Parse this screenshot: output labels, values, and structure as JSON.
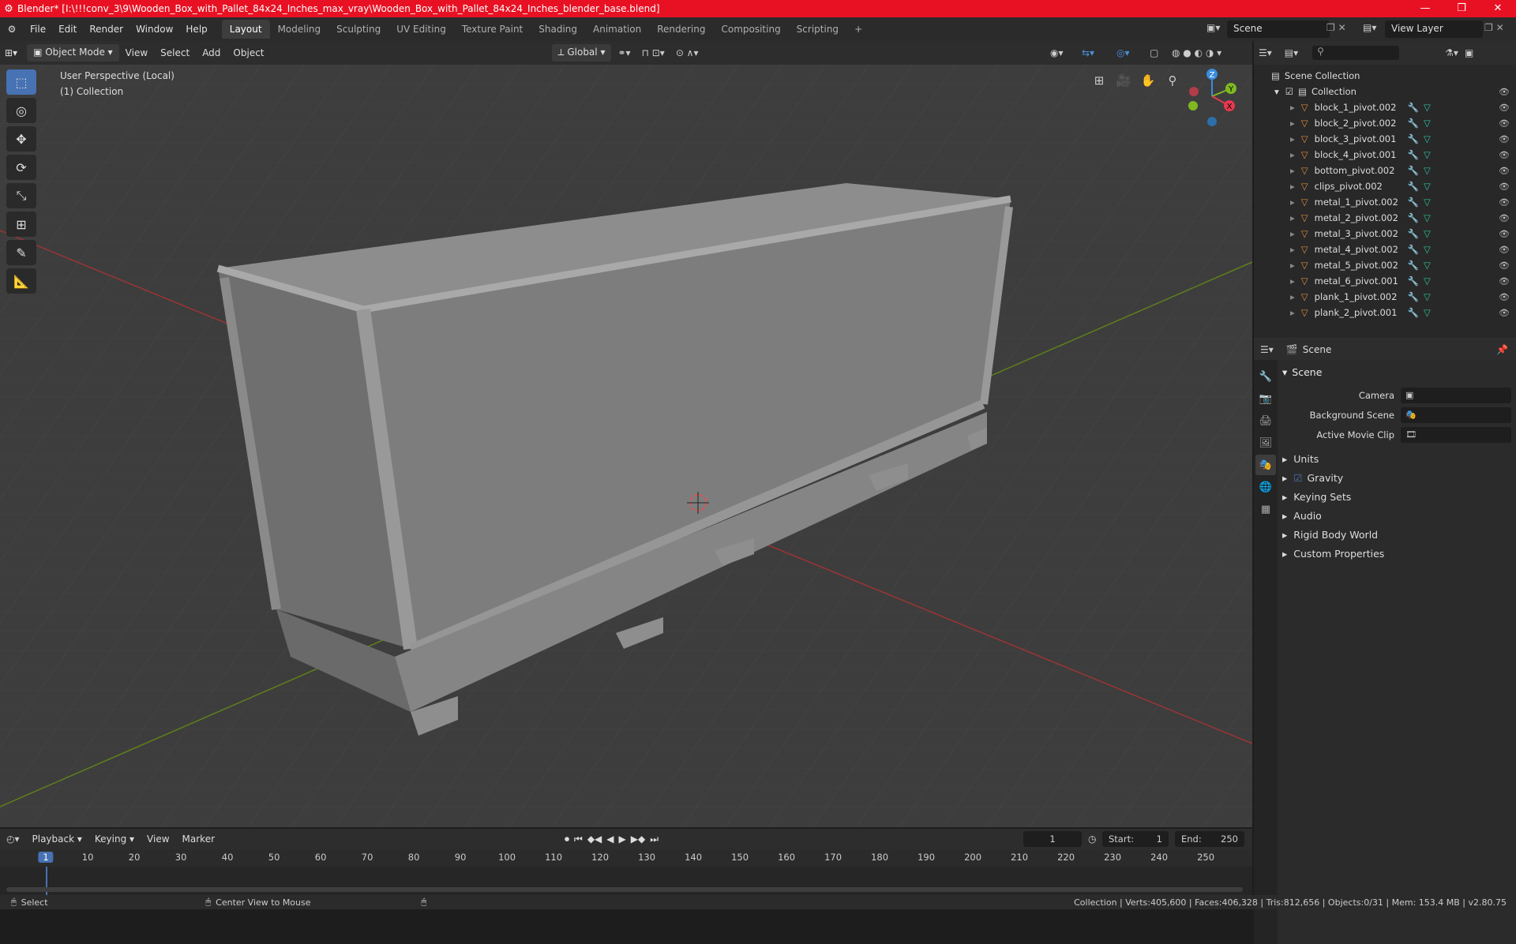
{
  "window": {
    "title": "Blender* [I:\\!!!conv_3\\9\\Wooden_Box_with_Pallet_84x24_Inches_max_vray\\Wooden_Box_with_Pallet_84x24_Inches_blender_base.blend]"
  },
  "menu": [
    "File",
    "Edit",
    "Render",
    "Window",
    "Help"
  ],
  "workspaces": [
    "Layout",
    "Modeling",
    "Sculpting",
    "UV Editing",
    "Texture Paint",
    "Shading",
    "Animation",
    "Rendering",
    "Compositing",
    "Scripting",
    "+"
  ],
  "scene_field": "Scene",
  "view_layer_field": "View Layer",
  "viewport_header": {
    "mode": "Object Mode",
    "view": "View",
    "select": "Select",
    "add": "Add",
    "object": "Object",
    "orientation": "Global"
  },
  "viewport": {
    "perspective": "User Perspective (Local)",
    "collection": "(1) Collection"
  },
  "gizmo": {
    "x": "X",
    "y": "Y",
    "z": "Z",
    "colors": {
      "x": "#e8384f",
      "y": "#7fb821",
      "z": "#3a8dde"
    }
  },
  "outliner": {
    "root": "Scene Collection",
    "collection": "Collection",
    "items": [
      "block_1_pivot.002",
      "block_2_pivot.002",
      "block_3_pivot.001",
      "block_4_pivot.001",
      "bottom_pivot.002",
      "clips_pivot.002",
      "metal_1_pivot.002",
      "metal_2_pivot.002",
      "metal_3_pivot.002",
      "metal_4_pivot.002",
      "metal_5_pivot.002",
      "metal_6_pivot.001",
      "plank_1_pivot.002",
      "plank_2_pivot.001"
    ]
  },
  "properties": {
    "header": "Scene",
    "panel": "Scene",
    "fields": [
      {
        "label": "Camera",
        "value": ""
      },
      {
        "label": "Background Scene",
        "value": ""
      },
      {
        "label": "Active Movie Clip",
        "value": ""
      }
    ],
    "subpanels": [
      "Units",
      "Gravity",
      "Keying Sets",
      "Audio",
      "Rigid Body World",
      "Custom Properties"
    ]
  },
  "timeline": {
    "menus": [
      "Playback",
      "Keying",
      "View",
      "Marker"
    ],
    "current_frame": "1",
    "start_label": "Start:",
    "start": "1",
    "end_label": "End:",
    "end": "250",
    "ruler": [
      "1",
      "10",
      "20",
      "30",
      "40",
      "50",
      "60",
      "70",
      "80",
      "90",
      "100",
      "110",
      "120",
      "130",
      "140",
      "150",
      "160",
      "170",
      "180",
      "190",
      "200",
      "210",
      "220",
      "230",
      "240",
      "250"
    ]
  },
  "statusbar": {
    "select": "Select",
    "center": "Center View to Mouse",
    "stats": "Collection | Verts:405,600 | Faces:406,328 | Tris:812,656 | Objects:0/31 | Mem: 153.4 MB | v2.80.75"
  },
  "colors": {
    "accent": "#4772b3",
    "title_bar": "#e81123",
    "x_axis": "#a83030",
    "y_axis": "#6a8c1e"
  }
}
